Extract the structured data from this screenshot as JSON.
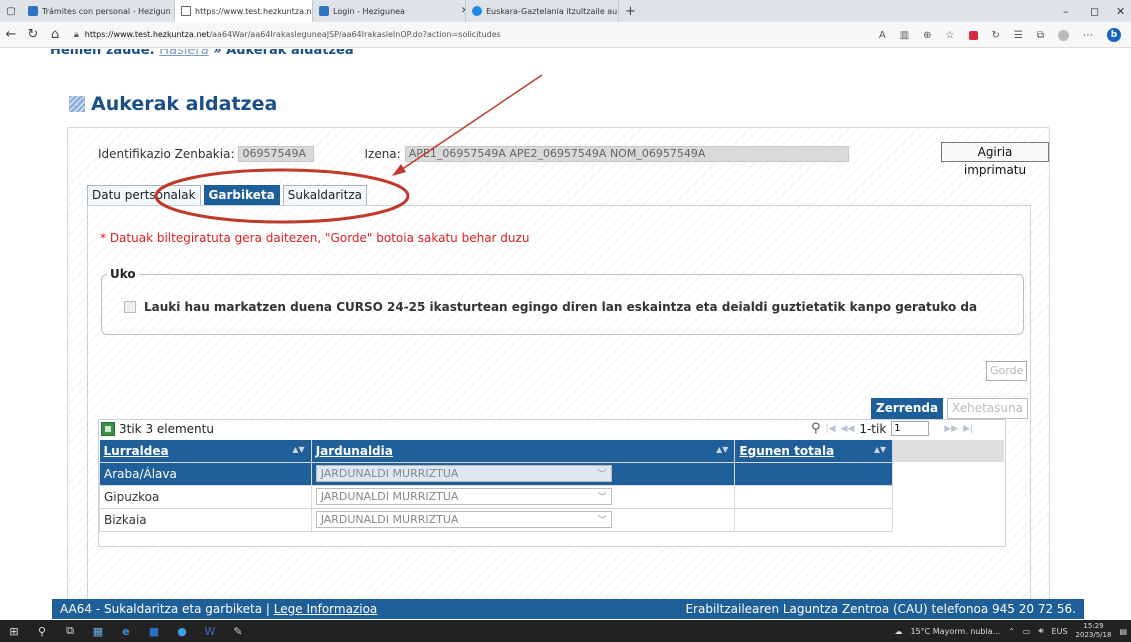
{
  "browser": {
    "tabs": [
      {
        "label": "Trámites con personal - Hezigun",
        "close": "✕"
      },
      {
        "label": "https://www.test.hezkuntza.net/a",
        "close": "✕"
      },
      {
        "label": "Login - Hezigunea",
        "close": "✕"
      },
      {
        "label": "Euskara-Gaztelania itzultzaile au",
        "close": "✕"
      }
    ],
    "new_tab": "+",
    "url_host": "https://www.test.hezkuntza.net",
    "url_path": "/aa64War/aa64IrakasleguneaJSP/aa64IrakasleInOP.do?action=solicitudes",
    "window_controls": {
      "minimize": "–",
      "restore": "◻",
      "close": "✕"
    }
  },
  "page": {
    "breadcrumb_prefix": "Hemen zaude:",
    "breadcrumb_link": "Hasiera",
    "breadcrumb_current": "» Aukerak aldatzea",
    "title": "Aukerak aldatzea",
    "id_label": "Identifikazio Zenbakia:",
    "id_value": "06957549A",
    "name_label": "Izena:",
    "name_value": "APE1_06957549A APE2_06957549A NOM_06957549A",
    "print_button": "Agiria imprimatu",
    "tabs": [
      "Datu pertsonalak",
      "Garbiketa",
      "Sukaldaritza"
    ],
    "warning": "* Datuak biltegiratuta gera daitezen, \"Gorde\" botoia sakatu behar duzu",
    "fieldset_legend": "Uko",
    "checkbox_label": "Lauki hau markatzen duena CURSO 24-25 ikasturtean egingo diren lan eskaintza eta deialdi guztietatik kanpo geratuko da",
    "save_button": "Gorde",
    "subtabs": [
      "Zerrenda",
      "Xehetasuna"
    ],
    "grid_count": "3tik 3 elementu",
    "pager_of": "1-tik",
    "pager_value": "1",
    "columns": [
      "Lurraldea",
      "Jardunaldia",
      "Egunen totala"
    ],
    "rows": [
      {
        "lurraldea": "Araba/Álava",
        "jardunaldia": "JARDUNALDI MURRIZTUA",
        "egunak": ""
      },
      {
        "lurraldea": "Gipuzkoa",
        "jardunaldia": "JARDUNALDI MURRIZTUA",
        "egunak": ""
      },
      {
        "lurraldea": "Bizkaia",
        "jardunaldia": "JARDUNALDI MURRIZTUA",
        "egunak": ""
      }
    ],
    "footer_left": "AA64 - Sukaldaritza eta garbiketa | ",
    "footer_link": "Lege Informazioa",
    "footer_right": "Erabiltzailearen Laguntza Zentroa (CAU) telefonoa 945 20 72 56."
  },
  "taskbar": {
    "weather": "15°C Mayorm. nubla...",
    "lang": "EUS",
    "time": "15:29",
    "date": "2023/5/18"
  },
  "colors": {
    "primary": "#1f5f99",
    "title": "#1b4f8a",
    "warning": "#e12020",
    "annotation": "#c0392b"
  }
}
